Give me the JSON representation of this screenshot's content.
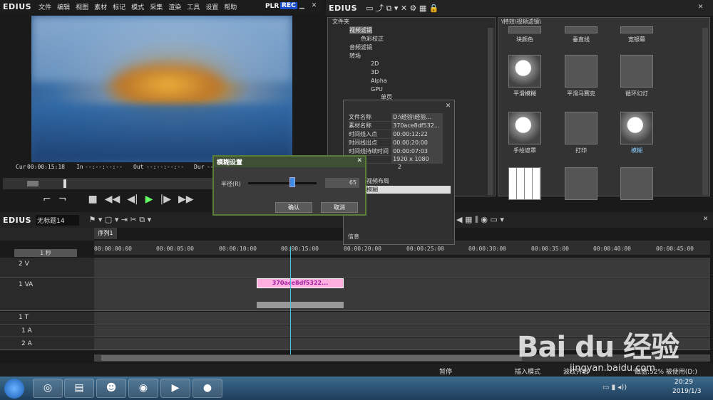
{
  "app": {
    "logo": "EDIUS",
    "plr": "PLR",
    "rec": "REC"
  },
  "menu": [
    "文件",
    "编辑",
    "视图",
    "素材",
    "标记",
    "模式",
    "采集",
    "渲染",
    "工具",
    "设置",
    "帮助"
  ],
  "timecode": {
    "cur_label": "Cur",
    "cur": "00:00:15:18",
    "in_label": "In",
    "in": "--:--:--:--",
    "out_label": "Out",
    "out": "--:--:--:--",
    "dur_label": "Dur",
    "dur": "--:--:--:--"
  },
  "bin": {
    "logo": "EDIUS",
    "folder_label": "文件夹",
    "path": "\\特效\\视频滤镜\\"
  },
  "tree": [
    "视频滤镜",
    "色彩校正",
    "音频滤镜",
    "转场",
    "2D",
    "3D",
    "Alpha",
    "GPU",
    "单页"
  ],
  "effects": [
    {
      "name": "块颜色"
    },
    {
      "name": "垂直线"
    },
    {
      "name": "宽银幕"
    },
    {
      "name": "平滑模糊"
    },
    {
      "name": "平滑马赛克"
    },
    {
      "name": "循环幻灯"
    },
    {
      "name": "手绘遮罩"
    },
    {
      "name": "打印"
    },
    {
      "name": "模糊"
    }
  ],
  "props": {
    "rows": [
      [
        "文件名称",
        "D:\\经验\\经验..."
      ],
      [
        "素材名称",
        "370ace8df532..."
      ],
      [
        "时间线入点",
        "00:00:12:22"
      ],
      [
        "时间线出点",
        "00:00:20:00"
      ],
      [
        "时间线持续时间",
        "00:00:07:03"
      ],
      [
        "",
        "1920 x 1080"
      ]
    ],
    "tab1": "2",
    "tab2": "2",
    "list": [
      "视频布局",
      "模糊"
    ],
    "info": "信息"
  },
  "dialog": {
    "title": "模糊设置",
    "radius_label": "半径(R)",
    "value": "65",
    "ok": "确认",
    "cancel": "取消"
  },
  "timeline": {
    "logo": "EDIUS",
    "project": "无标题14",
    "sequence": "序列1",
    "scale": "1 秒",
    "ruler": [
      "00:00:00:00",
      "00:00:05:00",
      "00:00:10:00",
      "00:00:15:00",
      "00:00:20:00",
      "00:00:25:00",
      "00:00:30:00",
      "00:00:35:00",
      "00:00:40:00",
      "00:00:45:00"
    ],
    "tracks": [
      "2 V",
      "1 VA",
      "1 T",
      "1 A",
      "2 A"
    ],
    "clip": "370ace8df5322..."
  },
  "status": {
    "pause": "暂停",
    "insert": "插入模式",
    "ripple": "波纹开启",
    "disk": "磁盘:52% 被使用(D:)"
  },
  "watermark": {
    "brand": "Bai du 经验",
    "url": "jingyan.baidu.com"
  },
  "clock": {
    "time": "20:29",
    "date": "2019/1/3"
  }
}
